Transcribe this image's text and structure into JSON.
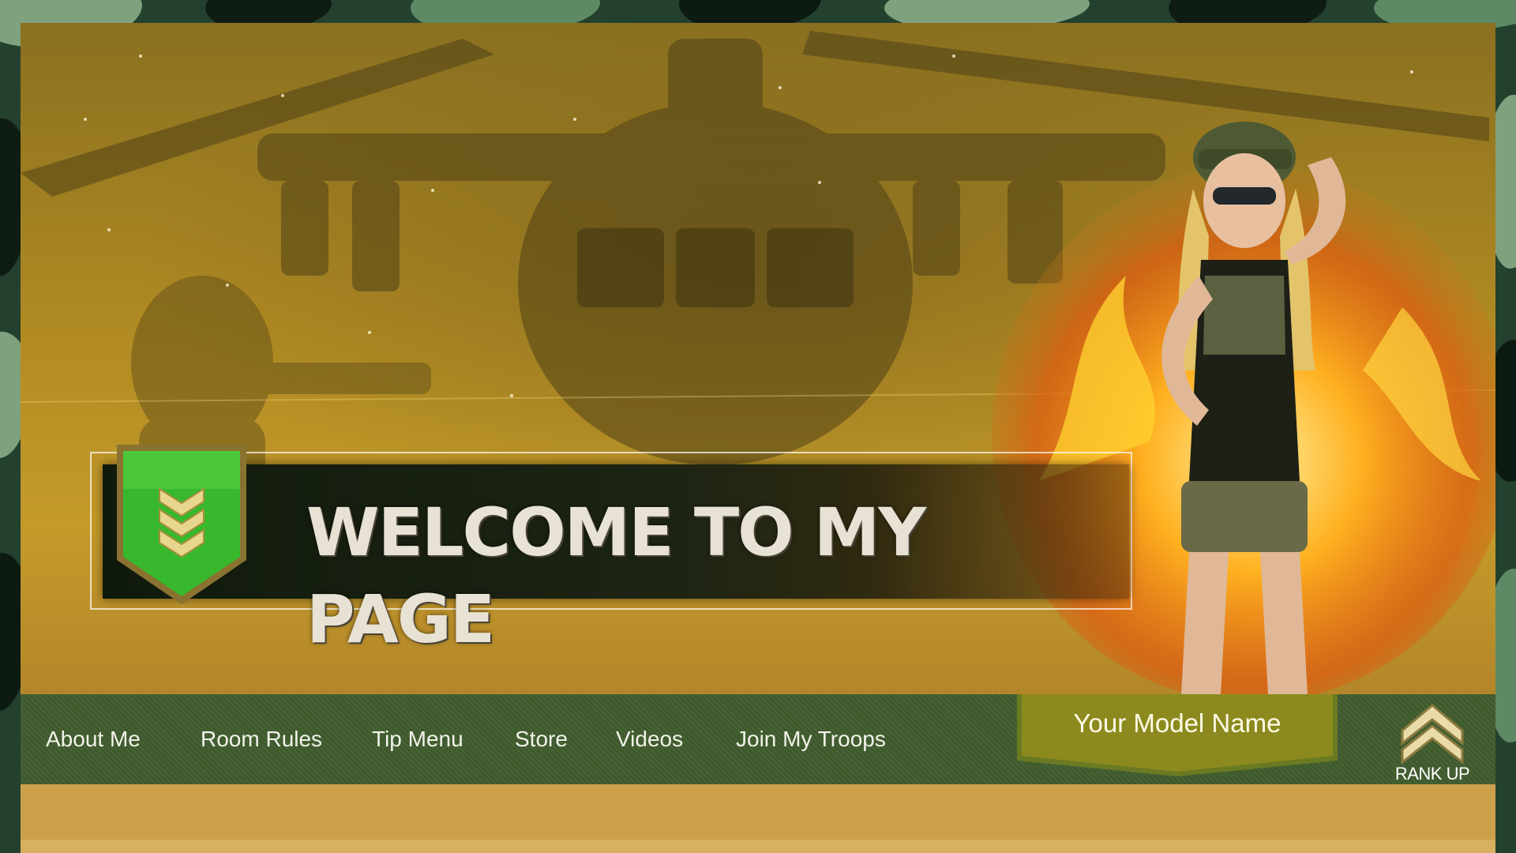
{
  "banner": {
    "title": "WELCOME TO MY PAGE"
  },
  "nav": {
    "items": [
      {
        "label": "About Me"
      },
      {
        "label": "Room Rules"
      },
      {
        "label": "Tip Menu"
      },
      {
        "label": "Store"
      },
      {
        "label": "Videos"
      },
      {
        "label": "Join My Troops"
      }
    ],
    "model_name": "Your Model Name",
    "rank_up_label": "RANK UP"
  },
  "colors": {
    "nav_background": "#3e5a2c",
    "name_tag": "#8c8a1e",
    "badge_green": "#38b82c",
    "hero_gold": "#b08a22",
    "page_gold": "#cda04c"
  },
  "icons": {
    "badge": "chevron-badge-icon",
    "rank": "rank-up-icon"
  }
}
